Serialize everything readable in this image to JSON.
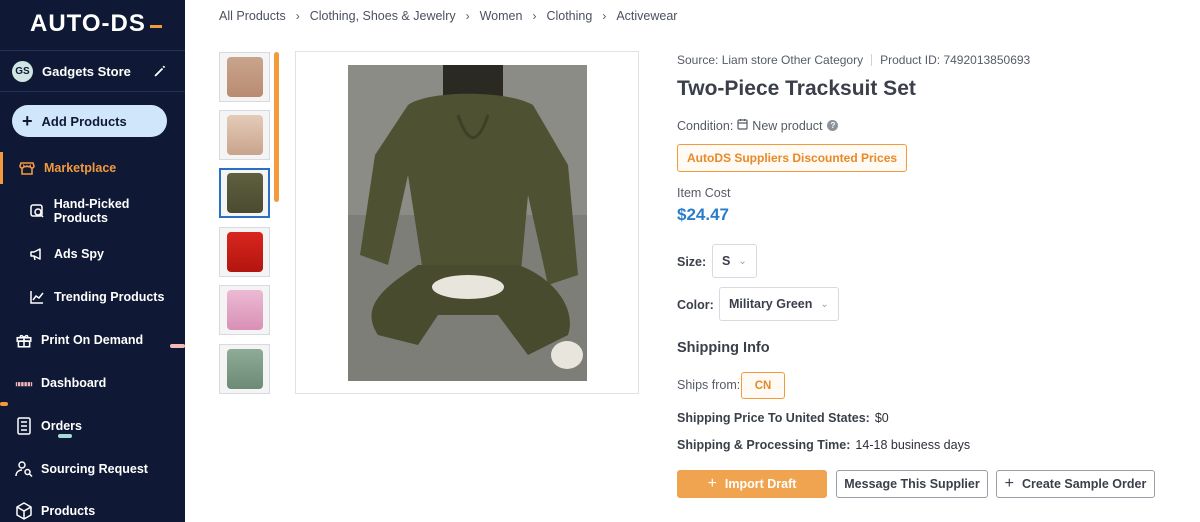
{
  "sidebar": {
    "logo": "AUTO-DS",
    "store": {
      "initials": "GS",
      "name": "Gadgets Store"
    },
    "add_products_label": "Add Products",
    "items": [
      {
        "label": "Marketplace",
        "icon": "store-icon",
        "active": true
      },
      {
        "label": "Hand-Picked Products",
        "icon": "hand-picked-icon"
      },
      {
        "label": "Ads Spy",
        "icon": "megaphone-icon"
      },
      {
        "label": "Trending Products",
        "icon": "trend-chart-icon"
      },
      {
        "label": "Print On Demand",
        "icon": "gift-box-icon"
      },
      {
        "label": "Dashboard",
        "icon": "gauge-icon"
      },
      {
        "label": "Orders",
        "icon": "list-doc-icon"
      },
      {
        "label": "Sourcing Request",
        "icon": "people-search-icon"
      },
      {
        "label": "Products",
        "icon": "package-icon"
      }
    ],
    "colors": {
      "bg": "#0f1834",
      "accent": "#f39a3d"
    }
  },
  "breadcrumb": [
    "All Products",
    "Clothing, Shoes & Jewelry",
    "Women",
    "Clothing",
    "Activewear"
  ],
  "product": {
    "source": "Source: Liam store Other Category",
    "product_id": "Product ID: 7492013850693",
    "title": "Two-Piece Tracksuit Set",
    "condition_label": "Condition:",
    "condition_value": "New product",
    "discount_badge": "AutoDS Suppliers Discounted Prices",
    "item_cost_label": "Item Cost",
    "item_cost": "$24.47",
    "size_label": "Size:",
    "size_value": "S",
    "color_label": "Color:",
    "color_value": "Military Green"
  },
  "thumbnails": [
    {
      "color": "#c9a48c",
      "selected": false
    },
    {
      "color": "#d5b8a4",
      "selected": false
    },
    {
      "color": "#5a5b3a",
      "selected": true
    },
    {
      "color": "#c8201c",
      "selected": false
    },
    {
      "color": "#e2a9c6",
      "selected": false
    },
    {
      "color": "#7c9a86",
      "selected": false
    }
  ],
  "shipping": {
    "title": "Shipping Info",
    "ships_from_label": "Ships from:",
    "ships_from_value": "CN",
    "price_label": "Shipping Price To United States:",
    "price_value": "$0",
    "time_label": "Shipping & Processing Time:",
    "time_value": "14-18 business days"
  },
  "actions": {
    "import_draft": "Import Draft",
    "message_supplier": "Message This Supplier",
    "create_sample": "Create Sample Order"
  }
}
